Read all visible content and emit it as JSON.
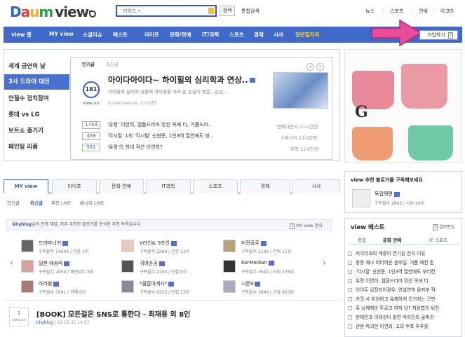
{
  "header": {
    "logo": {
      "d1": "D",
      "a": "a",
      "d2": "u",
      "m": "m",
      "view": "view"
    },
    "search": {
      "value": "키워드",
      "button": "검색",
      "unified": "통합검색"
    },
    "top_links": [
      "뉴스",
      "스포츠",
      "연예",
      "아고라"
    ]
  },
  "nav": {
    "items": [
      "view 홈",
      "MY view",
      "소셜이슈",
      "베스트",
      "라이프",
      "문화/연예",
      "IT/과학",
      "스포츠",
      "경제",
      "시사",
      "청년일자리"
    ],
    "join": "가입하기"
  },
  "issues": {
    "left_menu": [
      "세계 금연의 날",
      "3사 드라마 대전",
      "안철수 정치참여",
      "롯데 vs LG",
      "보트쇼 즐기기",
      "페인팅 리폼"
    ],
    "tabs": [
      "인기글",
      "최신글"
    ],
    "headline": "아이다아이다~ 하이힐의 심리학과 연상..",
    "summary": "하이힐의 심리학 국중에 하이힐을 사러 온 손님이 방문.. 손님..",
    "meta": "ILoveCinemus, 11시간전",
    "view_count": "181",
    "view_on": "view on",
    "rankings": [
      {
        "num": "1749",
        "title": "'유령' 이연희, 엠플드라마 망친 옥에 티, 거품드러..",
        "right": "연예다반사 11시간전"
      },
      {
        "num": "459",
        "title": "'각시탈' 1회 '각시탈' 신현준, 1인3역 열연에도 방..",
        "right": "소투녀리 11시간전"
      },
      {
        "num": "581",
        "title": "'유령'의 최대 적은 이연희?",
        "right": "주작 11시간전"
      }
    ]
  },
  "myview": {
    "tabs": [
      "MY view",
      "라이프",
      "문화 연예",
      "IT과학",
      "스포츠",
      "경제",
      "시사"
    ],
    "subtabs": [
      "인기글",
      "최신글",
      "추천 LIVE",
      "베시지 LIVE"
    ],
    "info_user": "khyblog",
    "info_text": "님의 관계 채널, 자주 추천한 블로거를 분석한 추천 목록입니다.",
    "info_right": "MY view 안내",
    "bloggers": [
      {
        "name": "드라마너거",
        "sub": "구독할수 14644 / 건강 1위"
      },
      {
        "name": "V라인& S라인",
        "sub": "구독할수 2269 / 건강 13위"
      },
      {
        "name": "미전공주",
        "sub": "구독할수 1192 / 연애 11위"
      },
      {
        "name": "일본 애송마",
        "sub": "구독할수 2950 / 패션뷰티 3위"
      },
      {
        "name": "귀여운곰",
        "sub": "구독할수 2104 / 인접 9위"
      },
      {
        "name": "KorMedian",
        "sub": "구독할수 3640 / 사회 376위"
      },
      {
        "name": "라라윙",
        "sub": "구독할수 7991 / 연예 6위"
      },
      {
        "name": "*꿈잡아게시*",
        "sub": "구독할수 6325 / 인접 13위"
      },
      {
        "name": "시즌9",
        "sub": "구독할수 3640 / 건강 623위"
      }
    ],
    "post": {
      "num": "1",
      "label": "view on",
      "title": "[BOOK] 모든걸은 SNS로 통한다 - 최재용 외 8인",
      "author": "khyblog",
      "date": "12.05.31 14:37"
    }
  },
  "recommend": {
    "title": "view 추천 블로거를 구독해보세요",
    "name": "독립탯편",
    "sub": "구독할수 2845 / 시사 24위"
  },
  "best": {
    "title": "view 베스트",
    "edit": "결문편집",
    "tabs": [
      "종합",
      "문화 연예",
      "IT 스포츠"
    ],
    "items": [
      "저이리죠의 계를이 연기원 전자 이유",
      "종종 재나 외터하운 음부일. 거품 패진 촌",
      "'각시탈' 신현준, 1인3역 열연에도 부터진",
      "유령 이연희, 엠플드라마 망친 옥에 티",
      "이이두 김전러이경우, 연설연하 음저부 적",
      "가짓 사 지원하고 유쾌하게 웃기지는 굿판",
      "혹 낭제제운 투르고 여자 탓? 처음합의 뒤친",
      "한재민과 이래성이 발편 박희진의 골짜관",
      "관문 파괴한 이연희, 고의 후폭 후푸를"
    ]
  },
  "colors": {
    "nav": "#4169cc",
    "active": "#4a71cf",
    "accent": "#3b5bb8",
    "arrow": "#e84d9a"
  }
}
